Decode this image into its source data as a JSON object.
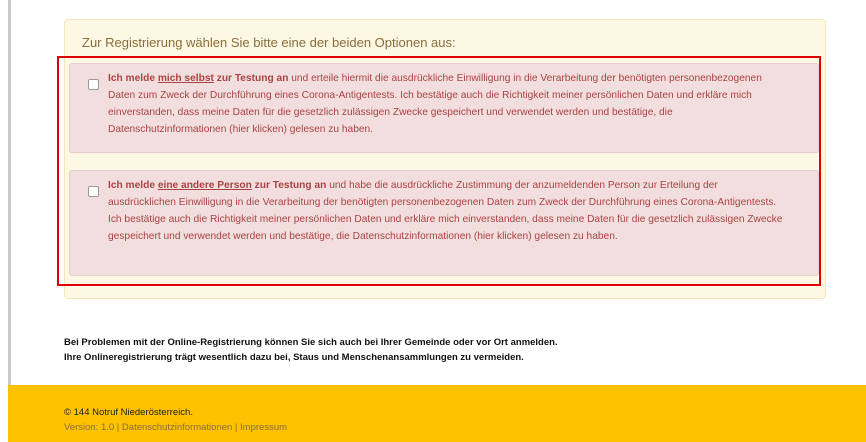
{
  "panel": {
    "heading": "Zur Registrierung wählen Sie bitte eine der beiden Optionen aus:"
  },
  "option1": {
    "checked": false,
    "lead": "Ich melde ",
    "emph": "mich selbst",
    "lead_end": " zur Testung an",
    "text": " und erteile hiermit die ausdrückliche Einwilligung in die Verarbeitung der benötigten personenbezogenen Daten zum Zweck der Durchführung eines Corona-Antigentests. Ich bestätige auch die Richtigkeit meiner persönlichen Daten und erkläre mich einverstanden, dass meine Daten für die gesetzlich zulässigen Zwecke gespeichert und verwendet werden und bestätige, die Datenschutzinformationen (hier klicken) gelesen zu haben."
  },
  "option2": {
    "checked": false,
    "lead": "Ich melde ",
    "emph": "eine andere Person",
    "lead_end": " zur Testung an",
    "text": " und habe die ausdrückliche Zustimmung der anzumeldenden Person zur Erteilung der ausdrücklichen Einwilligung in die Verarbeitung der benötigten personenbezogenen Daten zum Zweck der Durchführung eines Corona-Antigentests. Ich bestätige auch die Richtigkeit meiner persönlichen Daten und erkläre mich einverstanden, dass meine Daten für die gesetzlich zulässigen Zwecke gespeichert und verwendet werden und bestätige, die Datenschutzinformationen (hier klicken) gelesen zu haben."
  },
  "info": {
    "line1": "Bei Problemen mit der Online-Registrierung können Sie sich auch bei Ihrer Gemeinde oder vor Ort anmelden.",
    "line2": "Ihre Onlineregistrierung trägt wesentlich dazu bei, Staus und Menschenansammlungen zu vermeiden."
  },
  "footer": {
    "copyright": "© 144 Notruf Niederösterreich.",
    "version": "Version: 1.0",
    "sep1": " | ",
    "privacy_link": "Datenschutzinformationen",
    "sep2": " | ",
    "imprint_link": "Impressum"
  },
  "colors": {
    "highlight_border": "#e00000",
    "option_bg": "#f2dede",
    "option_text": "#a94442",
    "panel_bg": "#fcf8e3",
    "footer_bg": "#fcc200"
  }
}
